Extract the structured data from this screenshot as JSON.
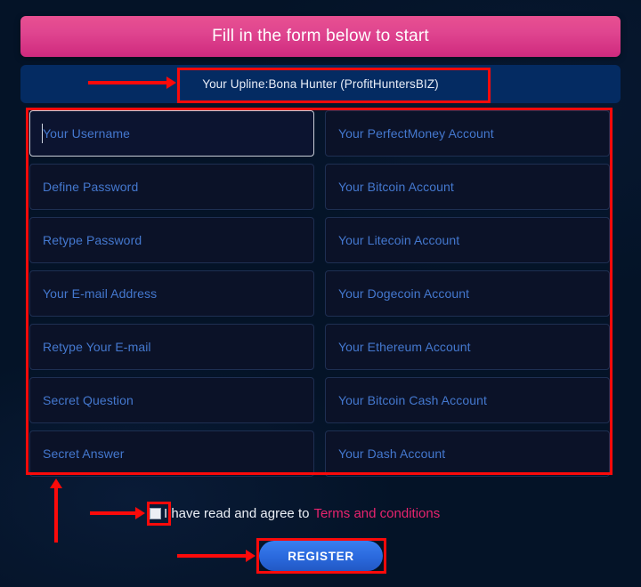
{
  "banner": {
    "title": "Fill in the form below to start"
  },
  "upline": {
    "text": "Your Upline:Bona Hunter (ProfitHuntersBIZ)"
  },
  "form": {
    "fields": [
      {
        "placeholder": "Your Username",
        "column": "left",
        "focused": true
      },
      {
        "placeholder": "Your PerfectMoney Account",
        "column": "right",
        "focused": false
      },
      {
        "placeholder": "Define Password",
        "column": "left",
        "focused": false
      },
      {
        "placeholder": "Your Bitcoin Account",
        "column": "right",
        "focused": false
      },
      {
        "placeholder": "Retype Password",
        "column": "left",
        "focused": false
      },
      {
        "placeholder": "Your Litecoin Account",
        "column": "right",
        "focused": false
      },
      {
        "placeholder": "Your E-mail Address",
        "column": "left",
        "focused": false
      },
      {
        "placeholder": "Your Dogecoin Account",
        "column": "right",
        "focused": false
      },
      {
        "placeholder": "Retype Your E-mail",
        "column": "left",
        "focused": false
      },
      {
        "placeholder": "Your Ethereum Account",
        "column": "right",
        "focused": false
      },
      {
        "placeholder": "Secret Question",
        "column": "left",
        "focused": false
      },
      {
        "placeholder": "Your Bitcoin Cash Account",
        "column": "right",
        "focused": false
      },
      {
        "placeholder": "Secret Answer",
        "column": "left",
        "focused": false
      },
      {
        "placeholder": "Your Dash Account",
        "column": "right",
        "focused": false
      }
    ]
  },
  "terms": {
    "checkbox_checked": false,
    "label": "I have read and agree to",
    "link_label": "Terms and conditions"
  },
  "submit": {
    "label": "REGISTER"
  },
  "colors": {
    "page_background": "#041327",
    "banner_gradient_start": "#e85091",
    "banner_gradient_end": "#cf2a7e",
    "upline_background": "#042b62",
    "field_background": "#0b1228",
    "field_border": "#1e2f52",
    "placeholder_text": "#4478cf",
    "focus_border": "#c8cdd6",
    "terms_link": "#e8246e",
    "register_button": "#2a69dd",
    "annotation_red": "#fb0a0a"
  }
}
